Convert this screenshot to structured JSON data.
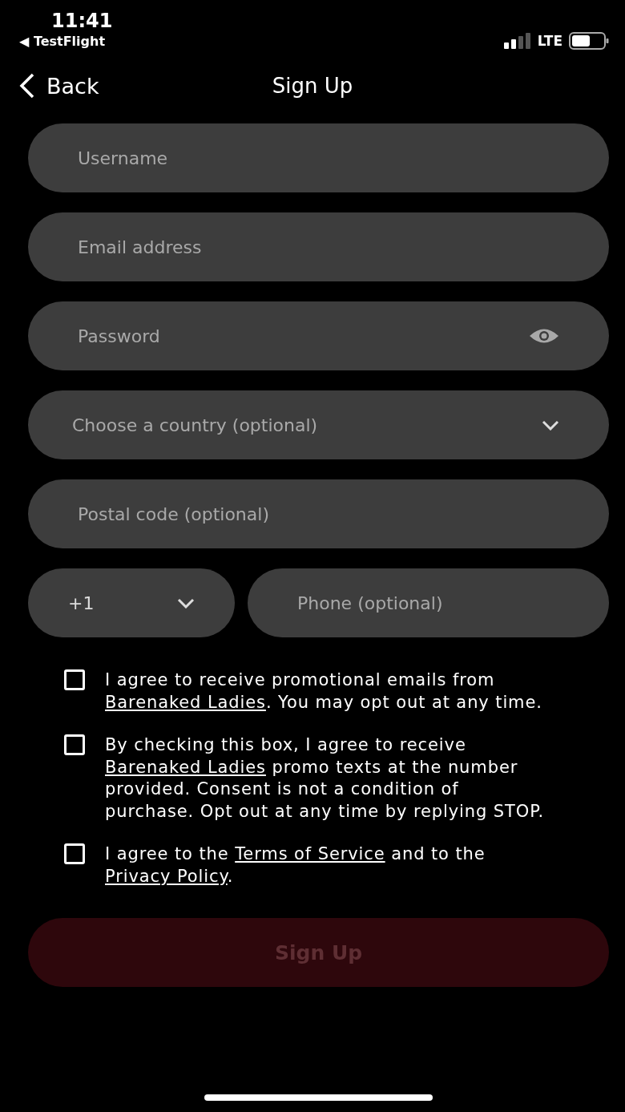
{
  "status_bar": {
    "time": "11:41",
    "back_app": "◀ TestFlight",
    "network": "LTE"
  },
  "nav": {
    "back": "Back",
    "title": "Sign Up"
  },
  "fields": [
    {
      "kind": "text",
      "placeholder": "Username"
    },
    {
      "kind": "text",
      "placeholder": "Email address"
    },
    {
      "kind": "password",
      "placeholder": "Password"
    },
    {
      "kind": "select",
      "placeholder": "Choose a country (optional)"
    },
    {
      "kind": "text",
      "placeholder": "Postal code (optional)"
    }
  ],
  "phone_row": {
    "code": "+1",
    "phone_placeholder": "Phone (optional)"
  },
  "agreements": [
    {
      "checked": false,
      "parts": [
        {
          "text": "I agree to receive promotional emails from ",
          "link": false
        },
        {
          "text": "Barenaked Ladies",
          "link": true
        },
        {
          "text": ". You may opt out at any time.",
          "link": false
        }
      ]
    },
    {
      "checked": false,
      "parts": [
        {
          "text": "By checking this box, I agree to receive ",
          "link": false
        },
        {
          "text": "Barenaked Ladies",
          "link": true
        },
        {
          "text": " promo texts at the number provided. Consent is not a condition of purchase. Opt out at any time by replying STOP.",
          "link": false
        }
      ]
    },
    {
      "checked": false,
      "parts": [
        {
          "text": "I agree to the ",
          "link": false
        },
        {
          "text": "Terms of Service",
          "link": true
        },
        {
          "text": " and to the ",
          "link": false
        },
        {
          "text": "Privacy Policy",
          "link": true
        },
        {
          "text": ".",
          "link": false
        }
      ]
    }
  ],
  "submit": {
    "label": "Sign Up",
    "disabled": true
  }
}
